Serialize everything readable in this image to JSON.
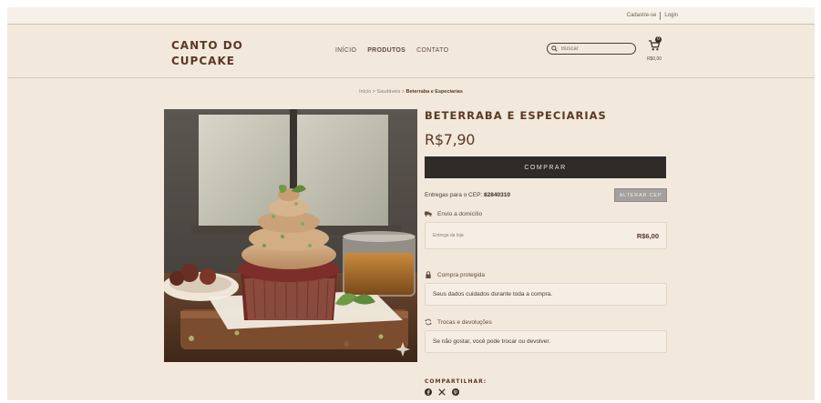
{
  "topbar": {
    "register": "Cadastre-se",
    "login": "Login"
  },
  "header": {
    "logo_line1": "CANTO DO",
    "logo_line2": "CUPCAKE",
    "nav": [
      "INÍCIO",
      "PRODUTOS",
      "CONTATO"
    ],
    "search_placeholder": "Buscar",
    "cart_count": "0",
    "cart_total": "R$0,00"
  },
  "breadcrumb": {
    "home": "Início",
    "category": "Saudáveis",
    "current": "Beterraba e Especiarias"
  },
  "product": {
    "title": "BETERRABA E ESPECIARIAS",
    "price": "R$7,90",
    "buy_label": "COMPRAR",
    "cep_label": "Entregas para o CEP:",
    "cep_value": "82840310",
    "change_cep_label": "ALTERAR CEP",
    "shipping_title": "Envio a domicílio",
    "shipping_option": "Entrega da loja",
    "shipping_price": "R$6,00",
    "secure_title": "Compra protegida",
    "secure_text": "Seus dados cuidados durante toda a compra.",
    "returns_title": "Trocas e devoluções",
    "returns_text": "Se não gostar, você pode trocar ou devolver."
  },
  "share": {
    "label": "COMPARTILHAR:",
    "icons": [
      "facebook-icon",
      "x-icon",
      "pinterest-icon"
    ]
  },
  "colors": {
    "brand": "#5a3826",
    "background": "#f3e8dc",
    "buy_button": "#2e2b29",
    "cep_button": "#a3a09d"
  }
}
